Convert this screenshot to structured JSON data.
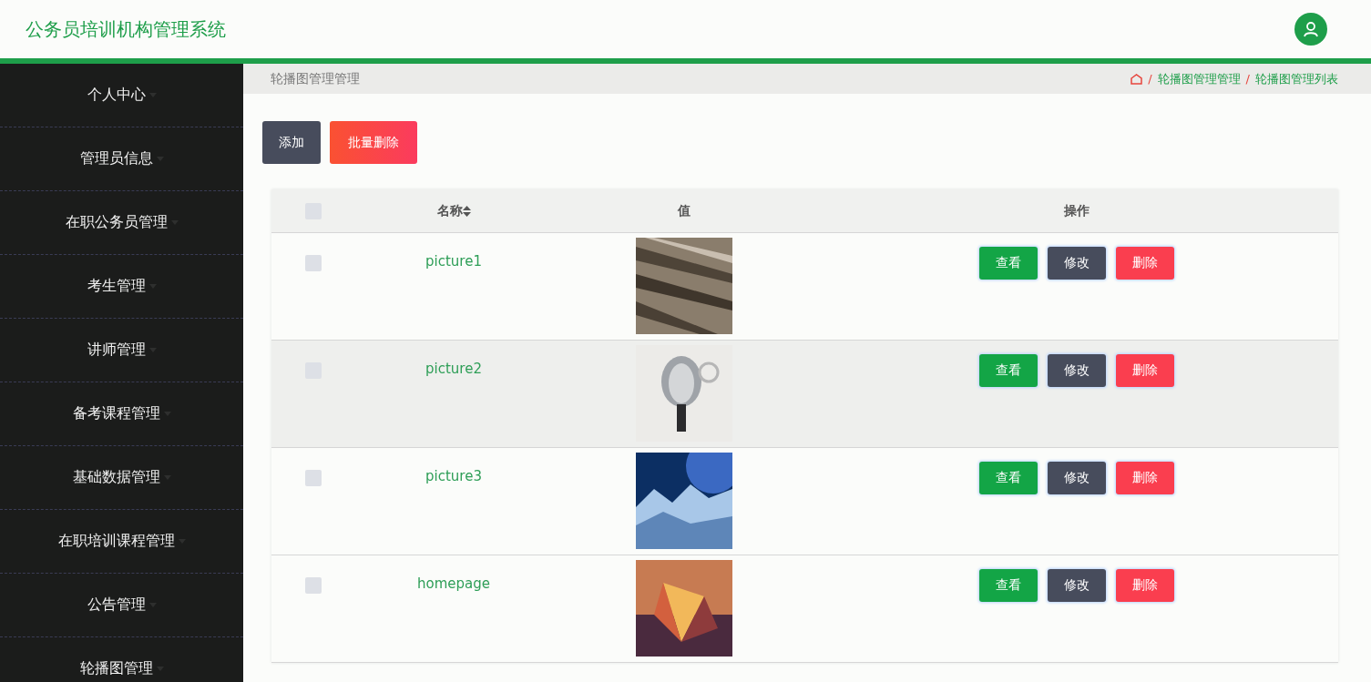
{
  "header": {
    "title": "公务员培训机构管理系统"
  },
  "sidebar": {
    "items": [
      {
        "label": "个人中心"
      },
      {
        "label": "管理员信息"
      },
      {
        "label": "在职公务员管理"
      },
      {
        "label": "考生管理"
      },
      {
        "label": "讲师管理"
      },
      {
        "label": "备考课程管理"
      },
      {
        "label": "基础数据管理"
      },
      {
        "label": "在职培训课程管理"
      },
      {
        "label": "公告管理"
      },
      {
        "label": "轮播图管理"
      }
    ]
  },
  "breadcrumb": {
    "title": "轮播图管理管理",
    "separator": "/",
    "path": [
      "轮播图管理管理",
      "轮播图管理列表"
    ]
  },
  "toolbar": {
    "add": "添加",
    "batch_delete": "批量删除"
  },
  "table": {
    "columns": [
      "名称",
      "值",
      "操作"
    ],
    "header_checked": false,
    "rows": [
      {
        "name": "picture1",
        "checked": false,
        "hovered": false,
        "actions": [
          "查看",
          "修改",
          "删除"
        ]
      },
      {
        "name": "picture2",
        "checked": false,
        "hovered": true,
        "actions": [
          "查看",
          "修改",
          "删除"
        ]
      },
      {
        "name": "picture3",
        "checked": false,
        "hovered": false,
        "actions": [
          "查看",
          "修改",
          "删除"
        ]
      },
      {
        "name": "homepage",
        "checked": false,
        "hovered": false,
        "actions": [
          "查看",
          "修改",
          "删除"
        ]
      }
    ]
  }
}
